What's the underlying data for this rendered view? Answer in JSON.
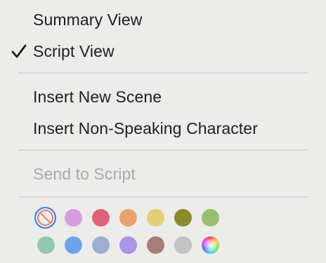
{
  "menu": {
    "items": [
      {
        "label": "Summary View",
        "checked": false,
        "enabled": true
      },
      {
        "label": "Script View",
        "checked": true,
        "enabled": true
      },
      {
        "label": "Insert New Scene",
        "checked": false,
        "enabled": true
      },
      {
        "label": "Insert Non-Speaking Character",
        "checked": false,
        "enabled": true
      },
      {
        "label": "Send to Script",
        "checked": false,
        "enabled": false
      }
    ],
    "check_icon": "checkmark-icon"
  },
  "colors": {
    "selected": "none",
    "row1": [
      {
        "name": "no-color",
        "hex": "none"
      },
      {
        "name": "pink",
        "hex": "#d99be0"
      },
      {
        "name": "red",
        "hex": "#de6377"
      },
      {
        "name": "orange",
        "hex": "#e8a26b"
      },
      {
        "name": "yellow",
        "hex": "#e6cd78"
      },
      {
        "name": "olive",
        "hex": "#8c8a2c"
      },
      {
        "name": "green",
        "hex": "#97bf72"
      }
    ],
    "row2": [
      {
        "name": "teal",
        "hex": "#92c8b3"
      },
      {
        "name": "blue",
        "hex": "#6ea3ec"
      },
      {
        "name": "slate",
        "hex": "#9eaed2"
      },
      {
        "name": "purple",
        "hex": "#ab93e6"
      },
      {
        "name": "brown",
        "hex": "#a77d77"
      },
      {
        "name": "gray",
        "hex": "#c2c2c2"
      },
      {
        "name": "custom",
        "hex": "rainbow"
      }
    ]
  }
}
